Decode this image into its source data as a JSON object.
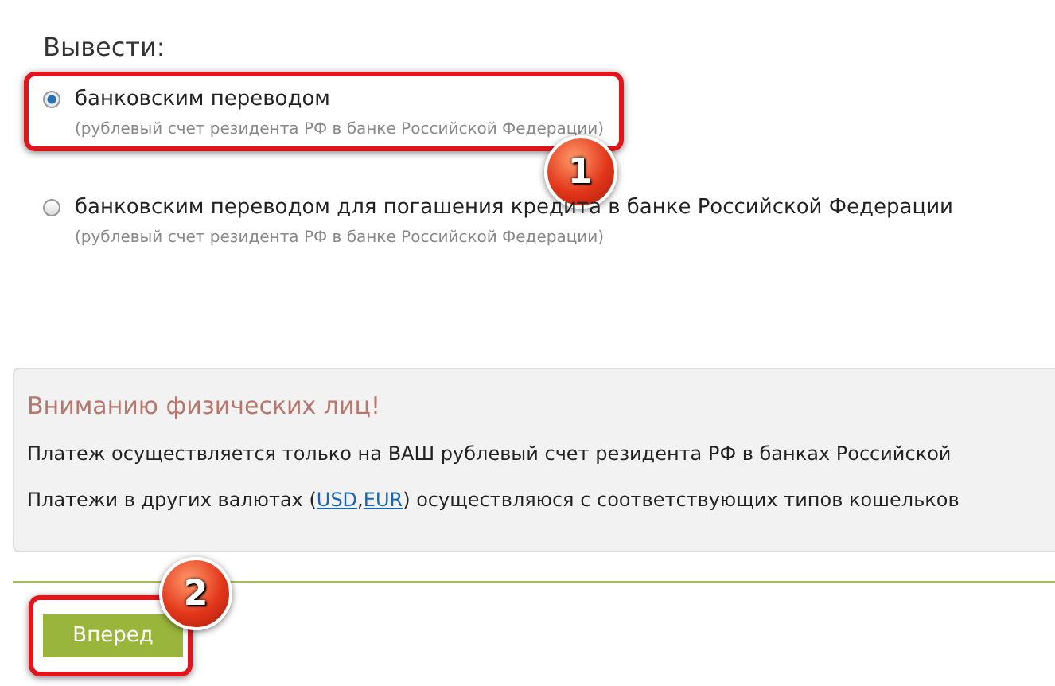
{
  "heading": "Вывести:",
  "options": [
    {
      "label": "банковским переводом",
      "note": "(рублевый счет резидента РФ в банке Российской Федерации)",
      "selected": true,
      "highlight": "1"
    },
    {
      "label": "банковским переводом для погашения кредита в банке Российской Федерации",
      "note": "(рублевый счет резидента РФ в банке Российской Федерации)",
      "selected": false
    }
  ],
  "notice": {
    "title": "Вниманию физических лиц!",
    "lines": [
      {
        "before": "Платеж осуществляется только на ВАШ рублевый счет резидента РФ в банках Российской"
      },
      {
        "before": "Платежи в других валютах (",
        "links": [
          "USD",
          "EUR"
        ],
        "separator": ",",
        "after": ") осуществляюся с соответствующих типов кошельков"
      }
    ]
  },
  "button": {
    "label": "Вперед",
    "highlight": "2"
  }
}
